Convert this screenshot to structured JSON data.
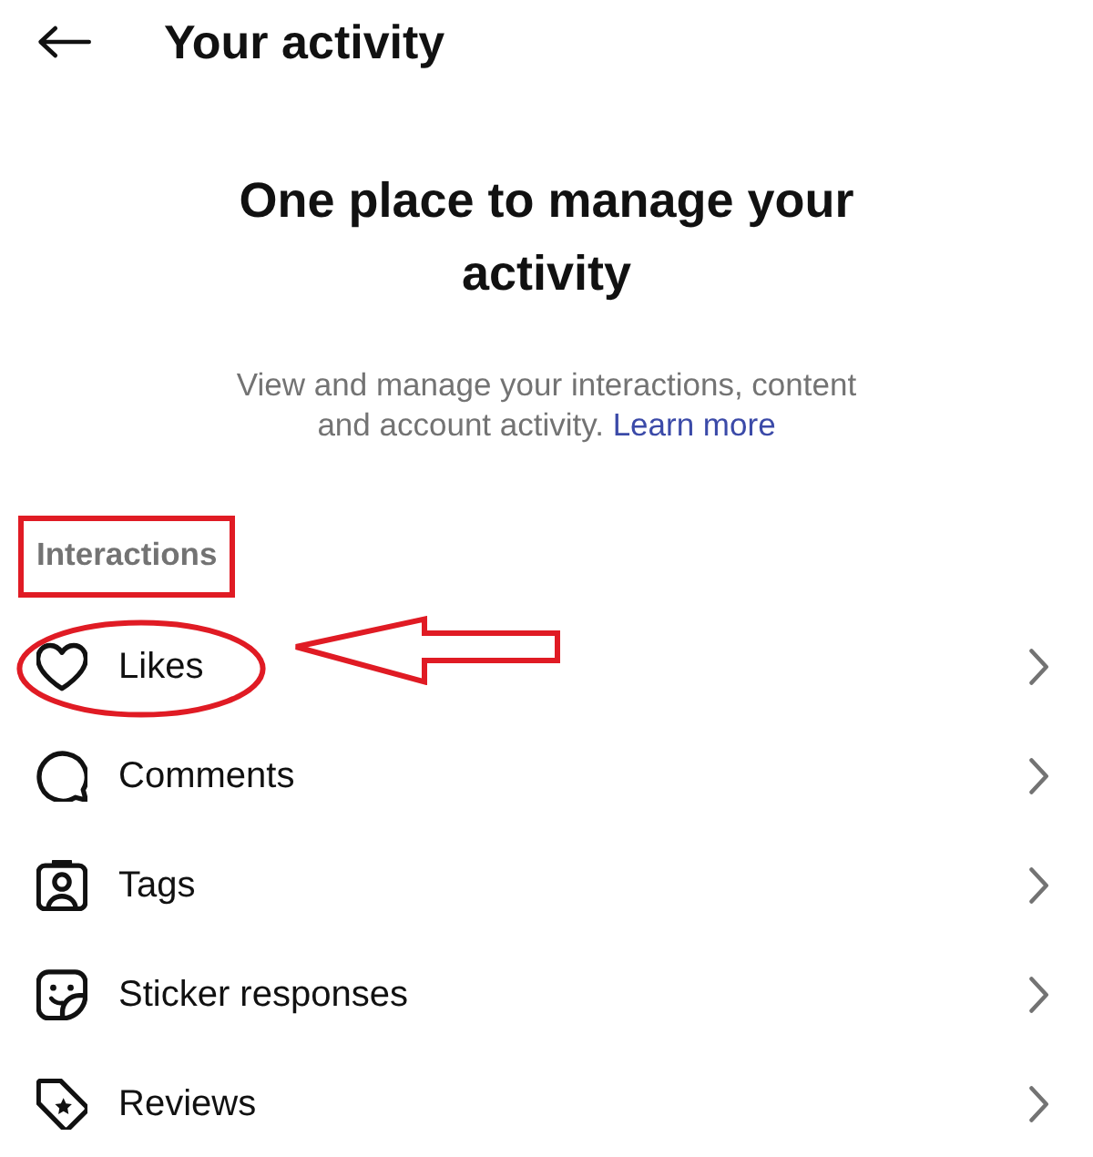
{
  "header": {
    "title": "Your activity"
  },
  "intro": {
    "heading": "One place to manage your activity",
    "description": "View and manage your interactions, content and account activity.",
    "link": "Learn more"
  },
  "sections": [
    {
      "title": "Interactions",
      "boxed": true,
      "items": [
        {
          "label": "Likes",
          "circled": true
        },
        {
          "label": "Comments",
          "circled": false
        },
        {
          "label": "Tags",
          "circled": false
        },
        {
          "label": "Sticker responses",
          "circled": false
        },
        {
          "label": "Reviews",
          "circled": false
        }
      ]
    }
  ]
}
